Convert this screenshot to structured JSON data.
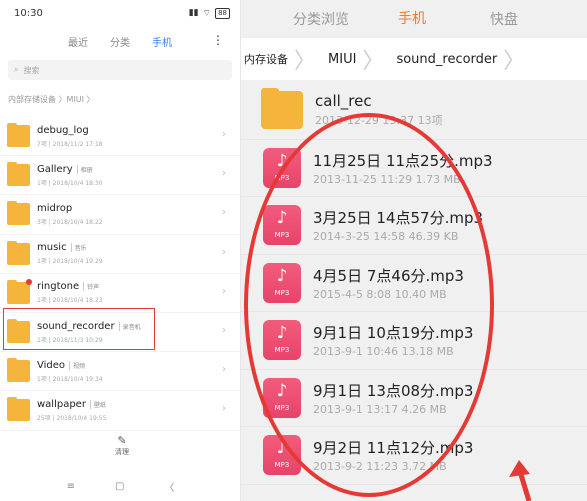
{
  "left": {
    "status": {
      "time": "10:30",
      "battery": "88"
    },
    "tabs": [
      "最近",
      "分类",
      "手机"
    ],
    "more": "⋮",
    "search_placeholder": "搜索",
    "breadcrumb": "内部存储设备 〉MIUI 〉",
    "folders": [
      {
        "name": "debug_log",
        "tag": "",
        "meta": "7项 | 2018/11/2 17:18"
      },
      {
        "name": "Gallery",
        "tag": "相册",
        "meta": "1项 | 2018/10/4 18:30"
      },
      {
        "name": "midrop",
        "tag": "",
        "meta": "3项 | 2018/10/4 18:22"
      },
      {
        "name": "music",
        "tag": "音乐",
        "meta": "1项 | 2018/10/4 19:29"
      },
      {
        "name": "ringtone",
        "tag": "铃声",
        "meta": "1项 | 2018/10/4 18:23"
      },
      {
        "name": "sound_recorder",
        "tag": "录音机",
        "meta": "1项 | 2018/11/3 10:29"
      },
      {
        "name": "Video",
        "tag": "视频",
        "meta": "1项 | 2018/10/4 19:34"
      },
      {
        "name": "wallpaper",
        "tag": "壁纸",
        "meta": "25项 | 2018/10/4 19:55"
      }
    ],
    "clean_label": "清理",
    "nav": [
      "≡",
      "▢",
      "〈"
    ]
  },
  "right": {
    "tabs": [
      "分类浏览",
      "手机",
      "快盘"
    ],
    "breadcrumb": [
      "内存设备",
      "MIUI",
      "sound_recorder"
    ],
    "items": [
      {
        "kind": "folder",
        "name": "call_rec",
        "meta": "2013-12-29 13:37  13项"
      },
      {
        "kind": "mp3",
        "name": "11月25日 11点25分.mp3",
        "meta": "2013-11-25 11:29  1.73 MB"
      },
      {
        "kind": "mp3",
        "name": "3月25日 14点57分.mp3",
        "meta": "2014-3-25 14:58  46.39 KB"
      },
      {
        "kind": "mp3",
        "name": "4月5日 7点46分.mp3",
        "meta": "2015-4-5 8:08  10.40 MB"
      },
      {
        "kind": "mp3",
        "name": "9月1日 10点19分.mp3",
        "meta": "2013-9-1 10:46  13.18 MB"
      },
      {
        "kind": "mp3",
        "name": "9月1日 13点08分.mp3",
        "meta": "2013-9-1 13:17  4.26 MB"
      },
      {
        "kind": "mp3",
        "name": "9月2日 11点12分.mp3",
        "meta": "2013-9-2 11:23  3.72 MB"
      }
    ],
    "mp3_label": "MP3",
    "note_glyph": "♪"
  }
}
